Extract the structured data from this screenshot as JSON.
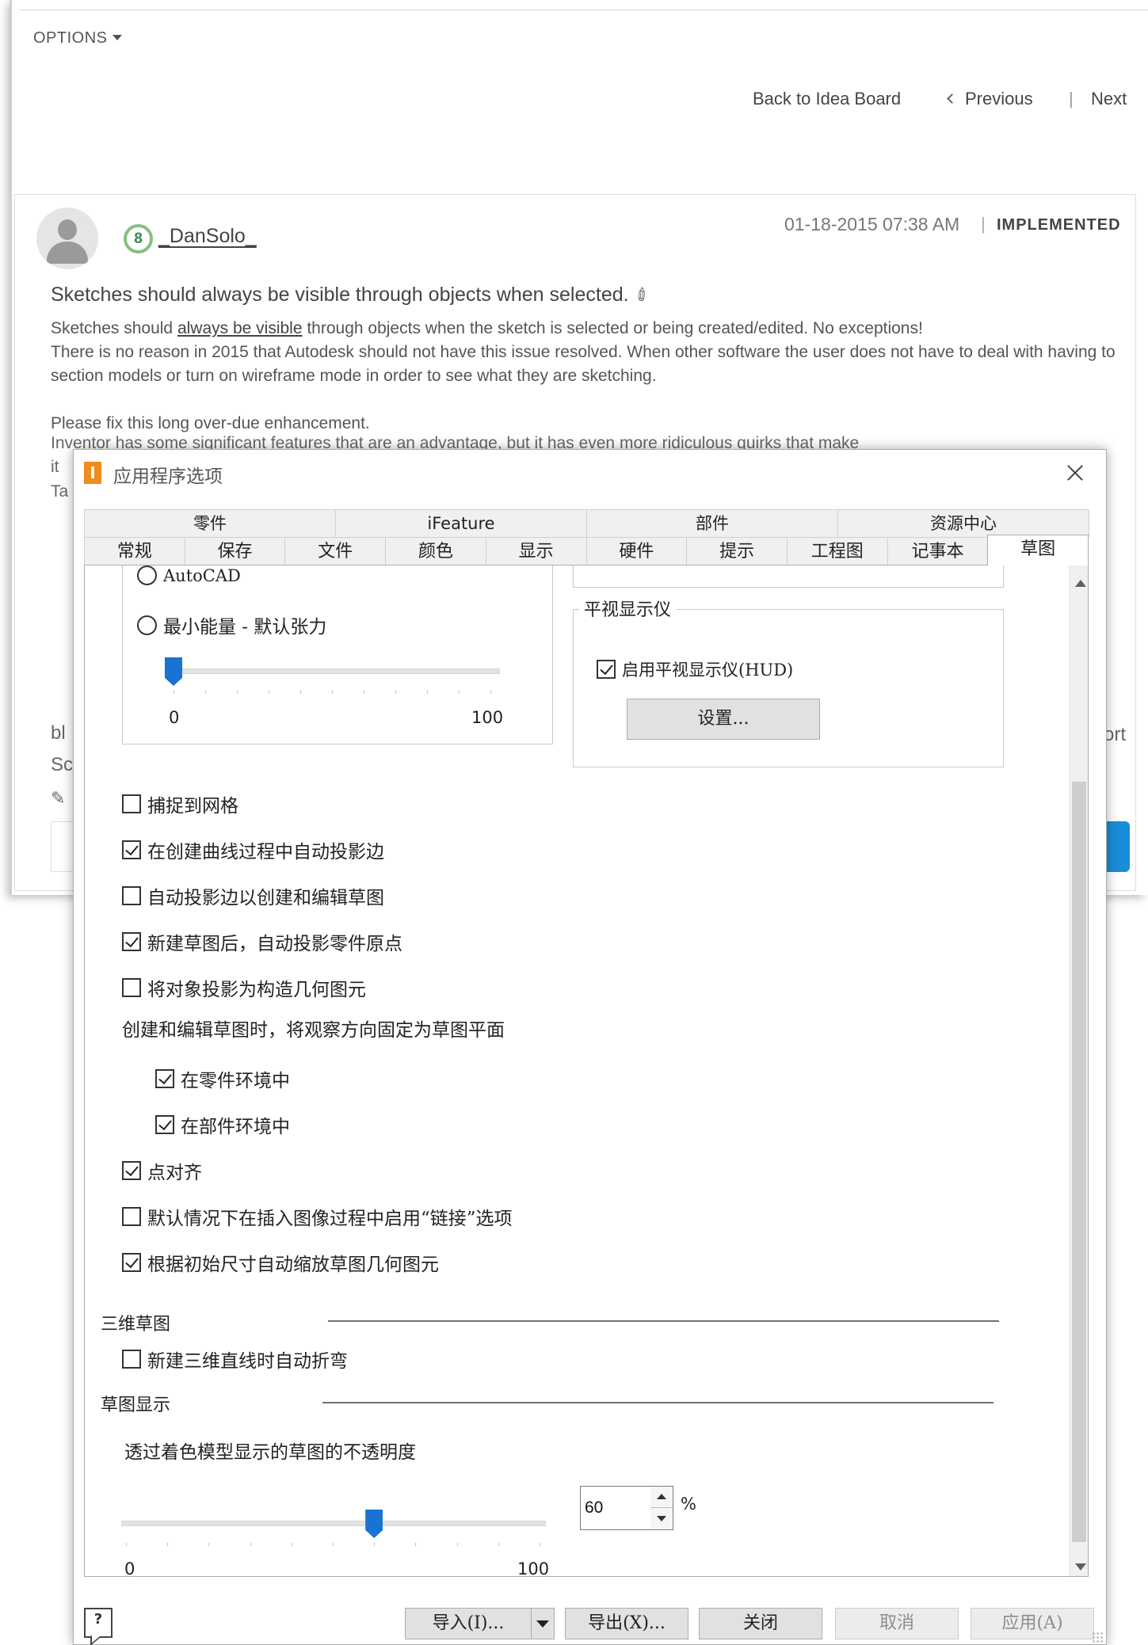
{
  "webpage": {
    "options_label": "OPTIONS",
    "nav": {
      "back": "Back to Idea Board",
      "previous": "Previous",
      "separator": "|",
      "next": "Next"
    },
    "post": {
      "rank": "8",
      "username": "_DanSolo_",
      "date": "01-18-2015 07:38 AM",
      "date_separator": "|",
      "status": "IMPLEMENTED",
      "title": "Sketches should always be visible through objects when selected.",
      "body_pre": "Sketches should ",
      "body_emph": "always be visible",
      "body_post": " through objects when the sketch is selected or being created/edited. No exceptions!",
      "body_line2": "There is no reason in 2015 that Autodesk should not have this issue resolved. When other software the user does not have to deal with having to section models or turn on wireframe mode in order to see what they are sketching.",
      "body_line3": "Please fix this long over-due enhancement.",
      "body_cut": "Inventor has some significant features that are an advantage, but it has even more ridiculous quirks that make",
      "frag_it": "it",
      "frag_ta": "Ta",
      "frag_bl": "bl",
      "frag_sc": "Sc",
      "frag_ort": "ort"
    }
  },
  "dialog": {
    "title": "应用程序选项",
    "tabs_row1": [
      "零件",
      "iFeature",
      "部件",
      "资源中心"
    ],
    "tabs_row2": [
      "常规",
      "保存",
      "文件",
      "颜色",
      "显示",
      "硬件",
      "提示",
      "工程图",
      "记事本",
      "草图"
    ],
    "active_tab": "草图",
    "radios": {
      "autocad": "AutoCAD",
      "min_energy": "最小能量 - 默认张力"
    },
    "tension_slider": {
      "min": "0",
      "max": "100",
      "value": 0
    },
    "hud": {
      "legend": "平视显示仪",
      "enable_label": "启用平视显示仪(HUD)",
      "enable_checked": true,
      "settings_button": "设置..."
    },
    "options": [
      {
        "label": "捕捉到网格",
        "checked": false
      },
      {
        "label": "在创建曲线过程中自动投影边",
        "checked": true
      },
      {
        "label": "自动投影边以创建和编辑草图",
        "checked": false
      },
      {
        "label": "新建草图后，自动投影零件原点",
        "checked": true
      },
      {
        "label": "将对象投影为构造几何图元",
        "checked": false
      }
    ],
    "view_fix_label": "创建和编辑草图时，将观察方向固定为草图平面",
    "view_fix_options": [
      {
        "label": "在零件环境中",
        "checked": true
      },
      {
        "label": "在部件环境中",
        "checked": true
      }
    ],
    "options2": [
      {
        "label": "点对齐",
        "checked": true
      },
      {
        "label": "默认情况下在插入图像过程中启用“链接”选项",
        "checked": false
      },
      {
        "label": "根据初始尺寸自动缩放草图几何图元",
        "checked": true
      }
    ],
    "sketch3d": {
      "header": "三维草图",
      "auto_bend_label": "新建三维直线时自动折弯",
      "auto_bend_checked": false
    },
    "sketch_display": {
      "header": "草图显示",
      "opacity_label": "透过着色模型显示的草图的不透明度",
      "min": "0",
      "max": "100",
      "value": "60",
      "unit": "%",
      "slider_value": 60
    },
    "buttons": {
      "import": "导入(I)...",
      "export": "导出(X)...",
      "close": "关闭",
      "cancel": "取消",
      "apply": "应用(A)"
    },
    "help_icon": "help-icon",
    "colors": {
      "accent": "#1873d3",
      "logo": "#f08c1e",
      "web_button": "#1a8dd8"
    }
  }
}
